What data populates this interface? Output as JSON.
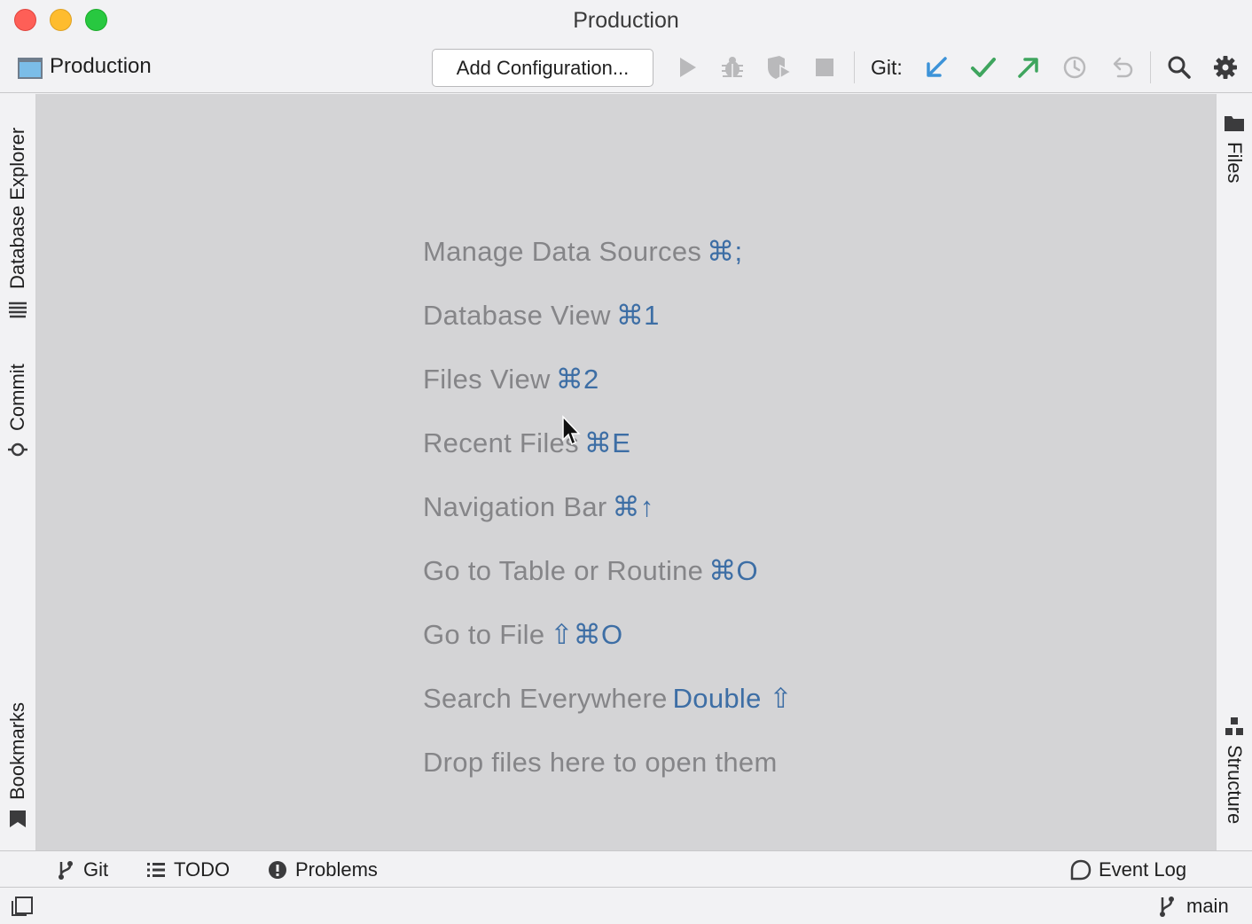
{
  "window": {
    "title": "Production",
    "controls": [
      "close",
      "minimize",
      "maximize"
    ]
  },
  "toolbar": {
    "project_name": "Production",
    "add_configuration_label": "Add Configuration...",
    "run_actions": [
      "play-icon",
      "debug-icon",
      "coverage-icon",
      "stop-icon"
    ],
    "git_label": "Git:",
    "git_actions": [
      "update-project-icon",
      "commit-icon",
      "push-icon",
      "history-icon",
      "rollback-icon"
    ],
    "right_actions": [
      "search-icon",
      "gear-icon"
    ],
    "colors": {
      "update": "#3d93d8",
      "commit": "#3fa55e",
      "push": "#3fa55e",
      "disabled": "#b9b9bb"
    }
  },
  "left_tool_windows": [
    {
      "label": "Database Explorer",
      "icon": "database-icon"
    },
    {
      "label": "Commit",
      "icon": "commit-node-icon"
    },
    {
      "label": "Bookmarks",
      "icon": "bookmark-icon"
    }
  ],
  "right_tool_windows": [
    {
      "label": "Files",
      "icon": "folder-icon"
    },
    {
      "label": "Structure",
      "icon": "structure-icon"
    }
  ],
  "editor": {
    "background": "#d4d4d6",
    "hints": [
      {
        "text": "Manage Data Sources",
        "shortcut": "⌘;"
      },
      {
        "text": "Database View",
        "shortcut": "⌘1"
      },
      {
        "text": "Files View",
        "shortcut": "⌘2"
      },
      {
        "text": "Recent Files",
        "shortcut": "⌘E"
      },
      {
        "text": "Navigation Bar",
        "shortcut": "⌘↑"
      },
      {
        "text": "Go to Table or Routine",
        "shortcut": "⌘O"
      },
      {
        "text": "Go to File",
        "shortcut": "⇧⌘O"
      },
      {
        "text": "Search Everywhere",
        "shortcut": "Double ⇧"
      },
      {
        "text": "Drop files here to open them",
        "shortcut": ""
      }
    ],
    "shortcut_color": "#3d6ea5"
  },
  "bottom_tabs": [
    {
      "label": "Git",
      "icon": "git-branch-icon"
    },
    {
      "label": "TODO",
      "icon": "list-icon"
    },
    {
      "label": "Problems",
      "icon": "problems-icon"
    }
  ],
  "event_log": {
    "label": "Event Log",
    "icon": "event-log-icon"
  },
  "status": {
    "branch": "main"
  }
}
